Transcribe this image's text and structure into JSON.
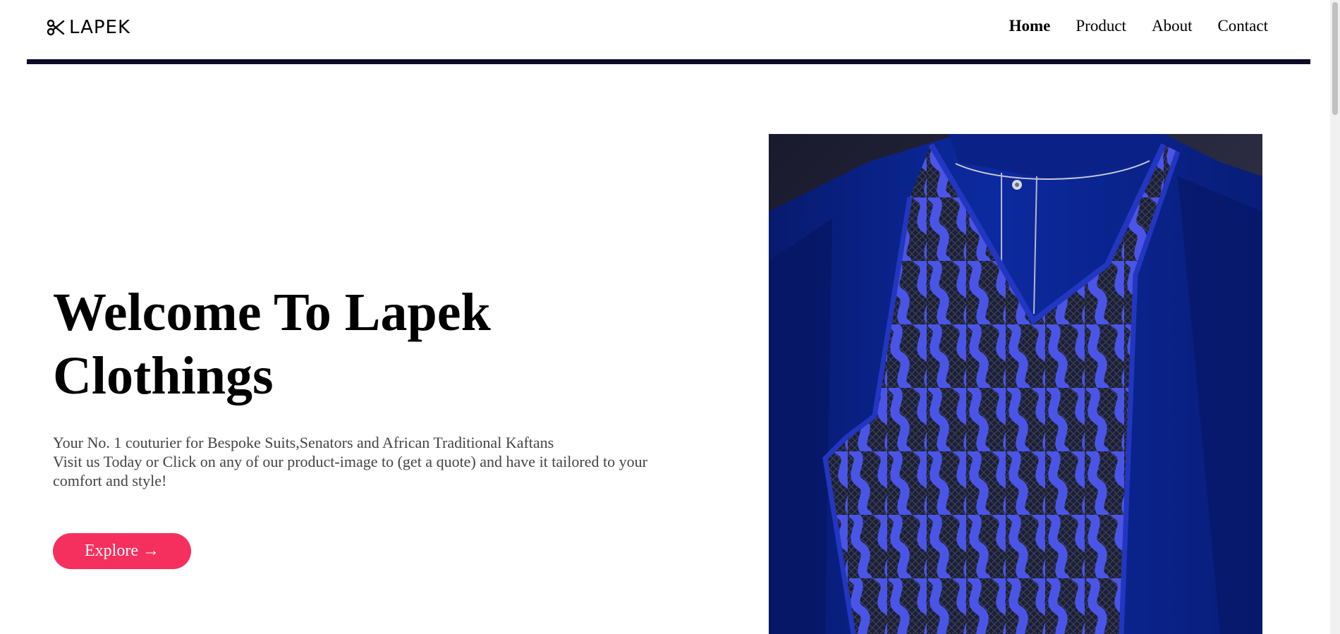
{
  "brand": {
    "name": "LAPEK",
    "logo_icon": "scissors-icon"
  },
  "nav": {
    "items": [
      {
        "label": "Home",
        "active": true
      },
      {
        "label": "Product",
        "active": false
      },
      {
        "label": "About",
        "active": false
      },
      {
        "label": "Contact",
        "active": false
      }
    ]
  },
  "hero": {
    "title_line1": "Welcome To Lapek",
    "title_line2": "Clothings",
    "description_line1": "Your No. 1 couturier for Bespoke Suits,Senators and African Traditional Kaftans",
    "description_line2": "Visit us Today or Click on any of our product-image to (get a quote) and have it tailored to your comfort and style!",
    "cta_label": "Explore →",
    "cta_color": "#f5305e"
  },
  "colors": {
    "header_rule": "#0c0a24",
    "garment_blue": "#0b2a9c",
    "embroidery_blue": "#4a55e8"
  }
}
